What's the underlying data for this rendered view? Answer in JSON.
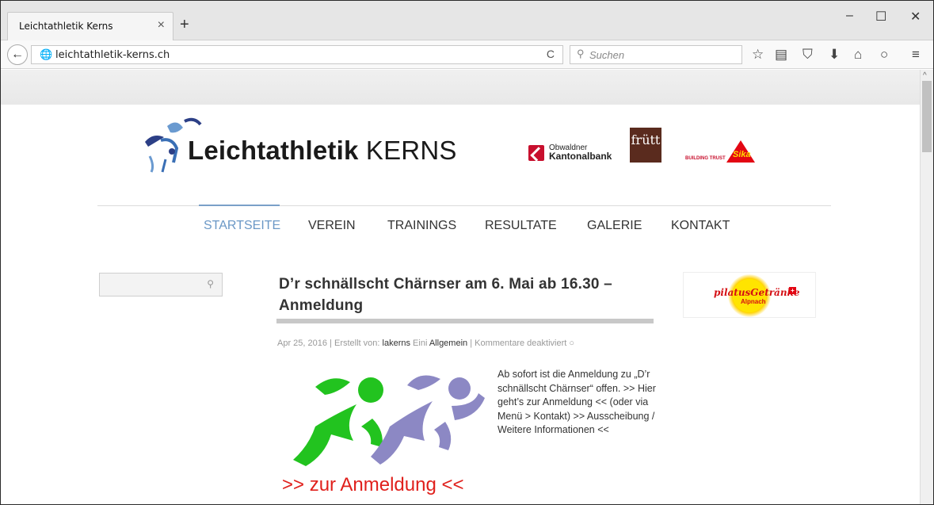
{
  "browser": {
    "tab_title": "Leichtathletik Kerns",
    "tab_close": "×",
    "new_tab": "+",
    "window_controls": {
      "minimize": "–",
      "maximize": "☐",
      "close": "✕"
    },
    "back_icon": "←",
    "url": "leichtathletik-kerns.ch",
    "reload_icon": "C",
    "search_placeholder": "Suchen",
    "toolbar_icons": [
      "star",
      "reading-list",
      "pocket",
      "download",
      "home",
      "chat",
      "menu"
    ]
  },
  "header": {
    "logo_bold": "Leichtathletik",
    "logo_light": "KERNS",
    "sponsors": {
      "okb_line1": "Obwaldner",
      "okb_line2": "Kantonalbank",
      "frutt": "frütt",
      "sika_tagline": "BUILDING TRUST",
      "sika": "Sika"
    }
  },
  "nav": {
    "items": [
      "STARTSEITE",
      "VEREIN",
      "TRAININGS",
      "RESULTATE",
      "GALERIE",
      "KONTAKT"
    ],
    "active_index": 0
  },
  "post": {
    "title": "D’r schnällscht Chärnser am 6. Mai ab 16.30 – Anmeldung",
    "meta_date": "Apr 25, 2016",
    "meta_author_prefix": "| Erstellt von:",
    "meta_author": "lakerns",
    "meta_ein": "Eini",
    "meta_category": "Allgemein",
    "meta_comments": "| Kommentare deaktiviert",
    "image_link": ">> zur Anmeldung <<",
    "body": "Ab sofort ist die Anmeldung zu „D’r schnällscht Chärnser“ offen. >> Hier geht’s zur Anmeldung << (oder via Menü > Kontakt) >> Ausscheibung / Weitere Informationen <<"
  },
  "sidebar": {
    "ad_name": "pilatusGetränke",
    "ad_town": "Alpnach",
    "ad_flag": "+"
  },
  "colors": {
    "nav_active": "#6b98c6",
    "runner_green": "#22c31f",
    "runner_purple": "#8c88c4",
    "link_red": "#e0201c"
  }
}
